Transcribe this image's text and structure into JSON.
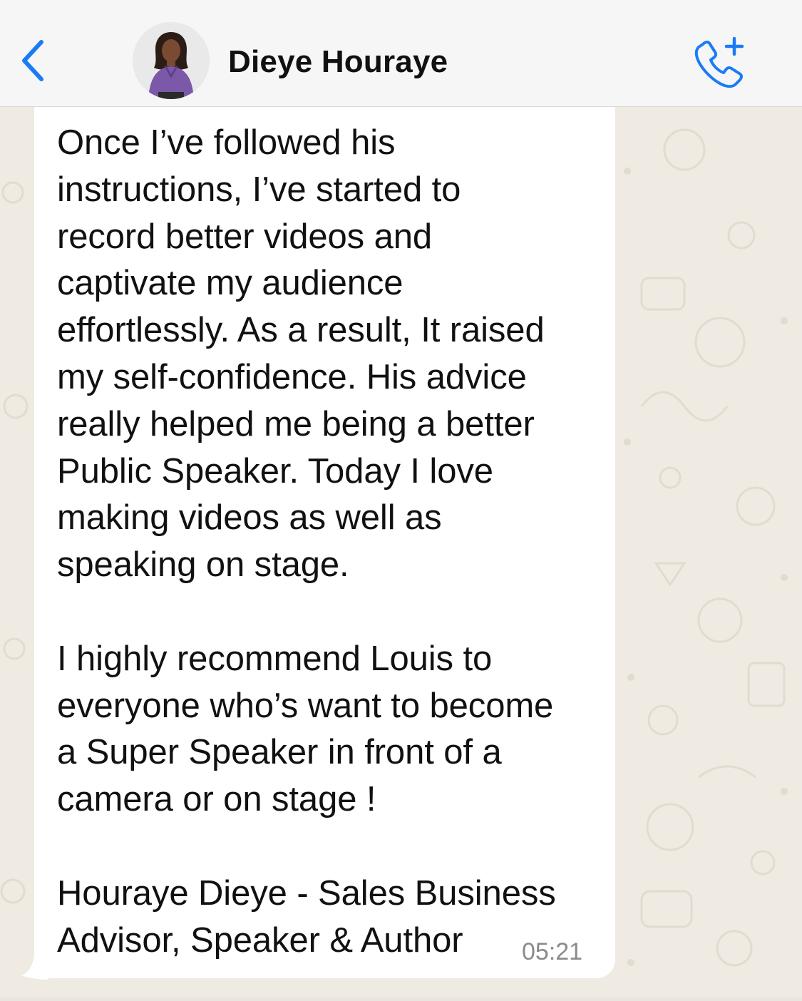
{
  "header": {
    "back_icon": "chevron-left-icon",
    "contact_name": "Dieye Houraye",
    "call_icon": "add-call-icon"
  },
  "message": {
    "text": "Once I’ve followed his\ninstructions, I’ve started to\nrecord better videos and\ncaptivate my audience\neffortlessly. As a result, It raised\nmy self-confidence. His advice\nreally helped me being a better\nPublic Speaker. Today I love\nmaking videos as well as\nspeaking on stage.\n\nI highly recommend Louis to\neveryone who’s want to become\na Super Speaker in front of a\ncamera or on stage !\n\nHouraye Dieye - Sales Business\nAdvisor, Speaker & Author",
    "time": "05:21"
  },
  "colors": {
    "accent": "#1a7cf5",
    "header_bg": "#f6f6f6",
    "wallpaper": "#efeae2",
    "bubble": "#ffffff",
    "timestamp": "#8a8a8a"
  }
}
